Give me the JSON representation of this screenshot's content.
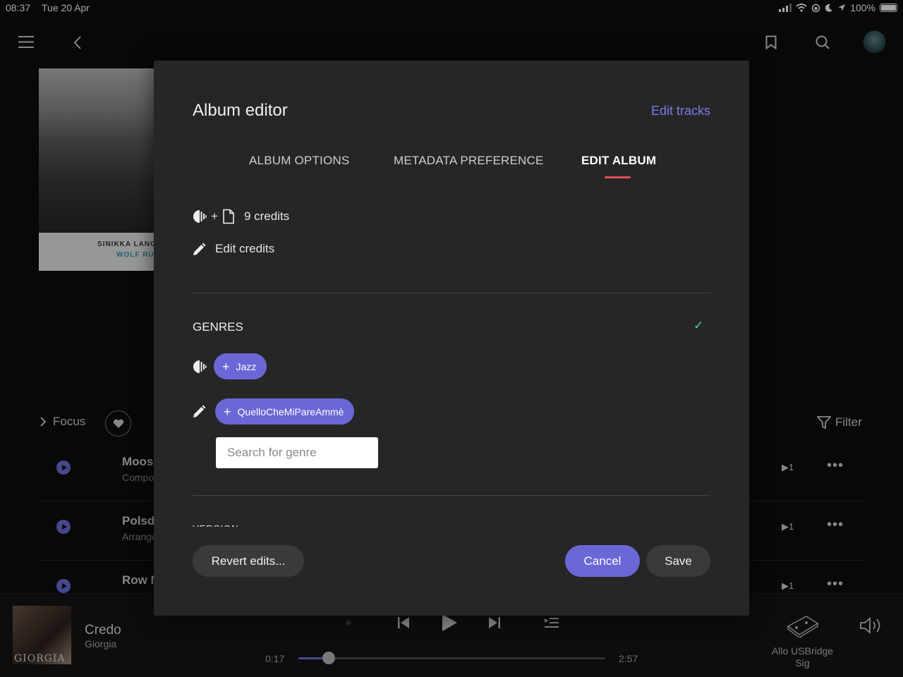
{
  "status_bar": {
    "time": "08:37",
    "date": "Tue 20 Apr",
    "battery": "100%"
  },
  "background": {
    "album_cover": {
      "caption_line1": "SINIKKA LANG",
      "caption_line2": "WOLF RU"
    },
    "focus_label": "Focus",
    "filter_label": "Filter",
    "tracks": [
      {
        "name": "Moos",
        "sub": "Compo",
        "count": "1"
      },
      {
        "name": "Polsd",
        "sub": "Arrange",
        "count": "1"
      },
      {
        "name": "Row N",
        "sub": "",
        "count": "1"
      }
    ]
  },
  "player": {
    "album_art_text": "GIORGIA",
    "title": "Credo",
    "artist": "Giorgia",
    "elapsed": "0:17",
    "duration": "2:57",
    "progress": 0.0994,
    "device_name": "Allo USBridge Sig"
  },
  "modal": {
    "title": "Album editor",
    "edit_tracks_link": "Edit tracks",
    "tabs": [
      {
        "label": "ALBUM OPTIONS",
        "active": false
      },
      {
        "label": "METADATA PREFERENCE",
        "active": false
      },
      {
        "label": "EDIT ALBUM",
        "active": true
      }
    ],
    "credits": {
      "plus": "+",
      "count_label": "9 credits"
    },
    "edit_credits_label": "Edit credits",
    "genres": {
      "heading": "GENRES",
      "check": "✓",
      "source_genre": "Jazz",
      "user_genre": "QuelloCheMiPareAmmè",
      "search_placeholder": "Search for genre"
    },
    "next_section_peek": "VERSION",
    "buttons": {
      "revert": "Revert edits...",
      "cancel": "Cancel",
      "save": "Save"
    }
  },
  "colors": {
    "accent": "#6b67d6",
    "link": "#7b7bea",
    "tab_indicator": "#e0505a",
    "check": "#4fd1b7",
    "modal_bg": "#262626"
  },
  "icons": [
    "menu-icon",
    "back-icon",
    "bookmark-icon",
    "search-icon",
    "avatar",
    "roon-source-icon",
    "file-icon",
    "pencil-icon",
    "plus-icon",
    "heart-icon",
    "filter-icon",
    "play-icon",
    "previous-icon",
    "next-icon",
    "queue-icon",
    "volume-icon",
    "device-icon"
  ]
}
